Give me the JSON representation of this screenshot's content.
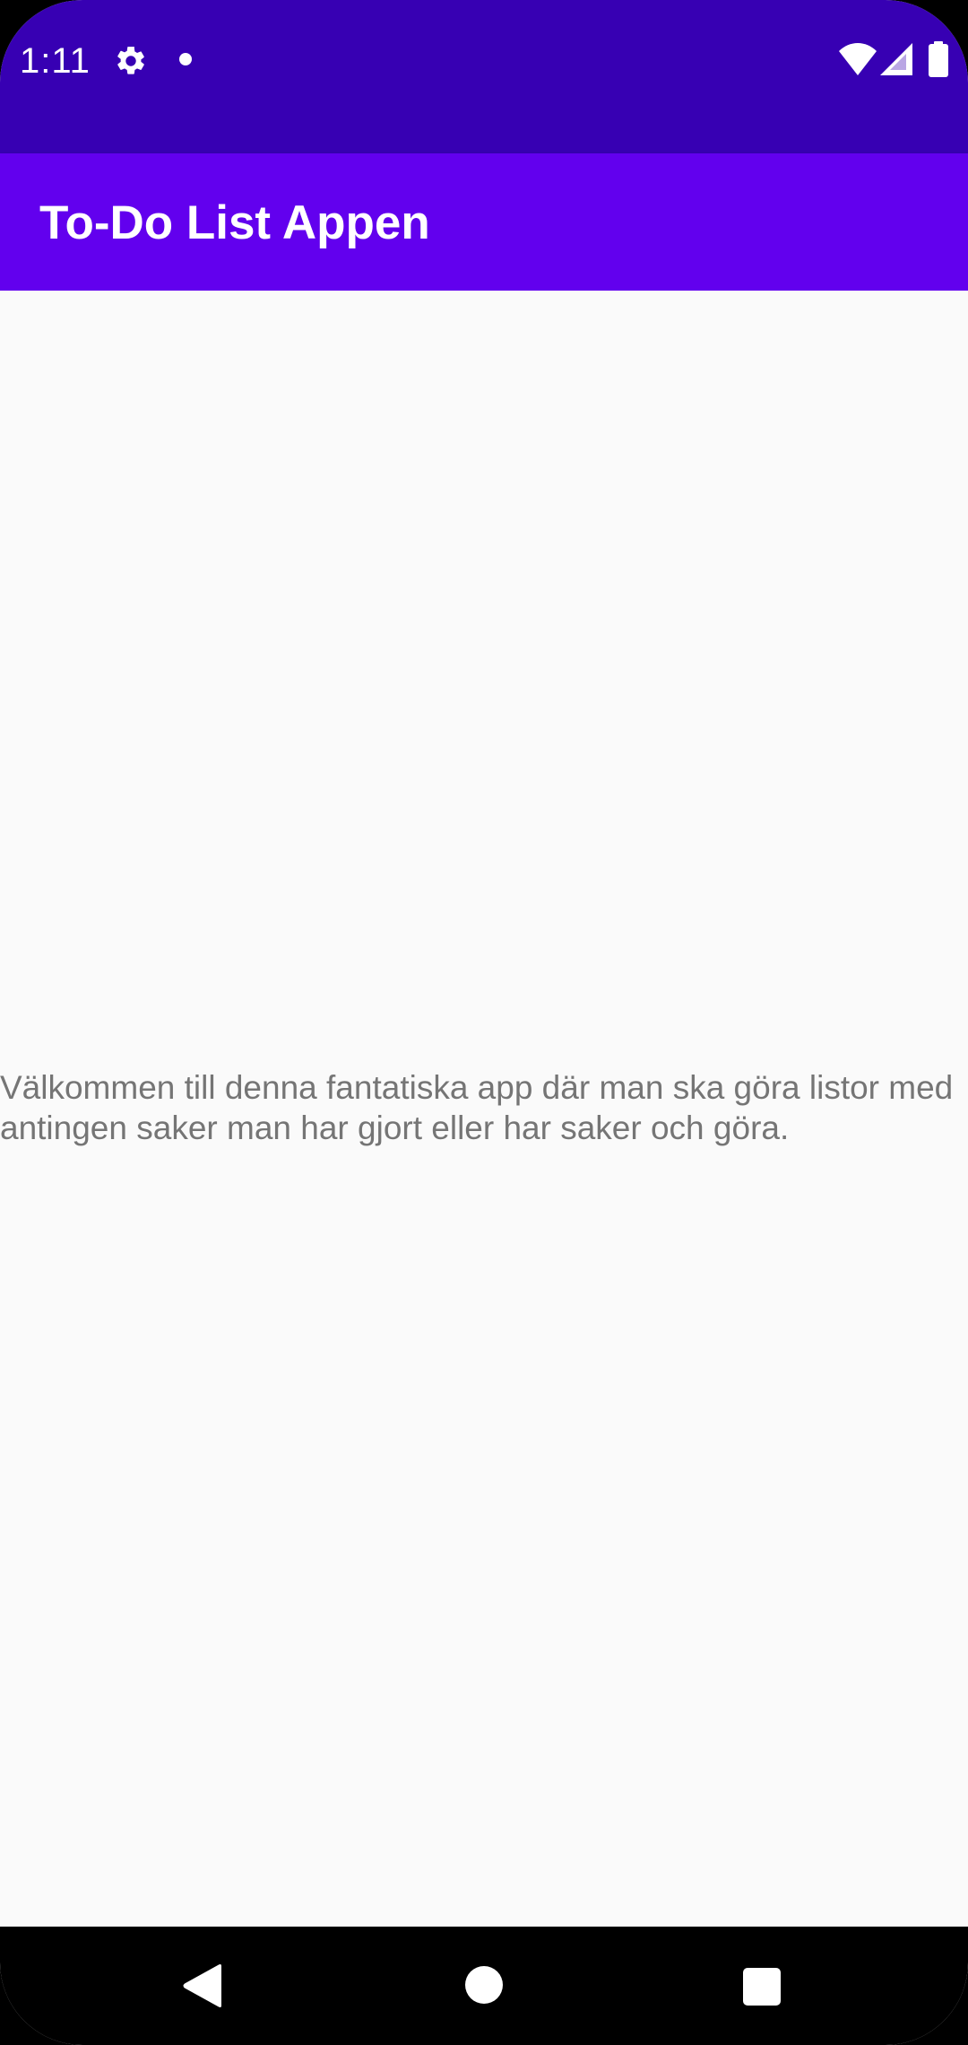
{
  "status_bar": {
    "time": "1:11",
    "icons": [
      "gear-icon",
      "notification-dot-icon",
      "wifi-icon",
      "cell-signal-icon",
      "battery-icon"
    ],
    "background_color": "#3700b3"
  },
  "app_bar": {
    "title": "To-Do List Appen",
    "background_color": "#6200ee"
  },
  "main": {
    "welcome_text": "Välkommen till denna fantatiska app där man ska göra listor med antingen saker man har gjort eller har saker och göra."
  },
  "nav_bar": {
    "icons": [
      "back-icon",
      "home-icon",
      "recents-icon"
    ]
  }
}
